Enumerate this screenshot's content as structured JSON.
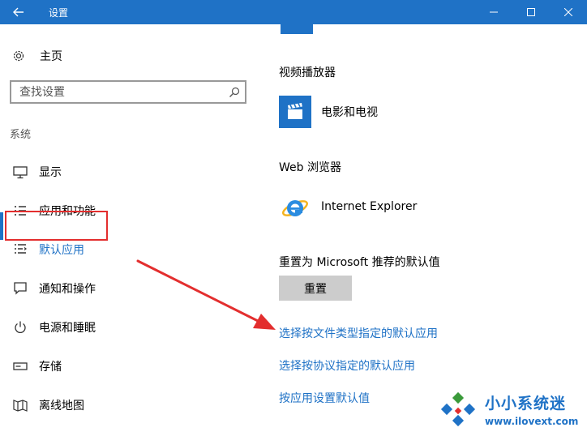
{
  "window": {
    "title": "设置",
    "controls": [
      "minimize",
      "maximize",
      "close"
    ]
  },
  "sidebar": {
    "home_label": "主页",
    "search_placeholder": "查找设置",
    "section_label": "系统",
    "items": [
      {
        "label": "显示",
        "icon": "monitor-icon"
      },
      {
        "label": "应用和功能",
        "icon": "list-icon"
      },
      {
        "label": "默认应用",
        "icon": "default-apps-icon",
        "selected": true
      },
      {
        "label": "通知和操作",
        "icon": "notification-icon"
      },
      {
        "label": "电源和睡眠",
        "icon": "power-icon"
      },
      {
        "label": "存储",
        "icon": "storage-icon"
      },
      {
        "label": "离线地图",
        "icon": "map-icon"
      }
    ]
  },
  "content": {
    "video_heading": "视频播放器",
    "video_app": "电影和电视",
    "browser_heading": "Web 浏览器",
    "browser_app": "Internet Explorer",
    "reset_heading": "重置为 Microsoft 推荐的默认值",
    "reset_button": "重置",
    "links": [
      "选择按文件类型指定的默认应用",
      "选择按协议指定的默认应用",
      "按应用设置默认值"
    ]
  },
  "colors": {
    "accent": "#1f72c6",
    "annotation": "#e32e2e"
  },
  "watermark": {
    "title": "小小系统迷",
    "url": "www.ilovext.com"
  }
}
